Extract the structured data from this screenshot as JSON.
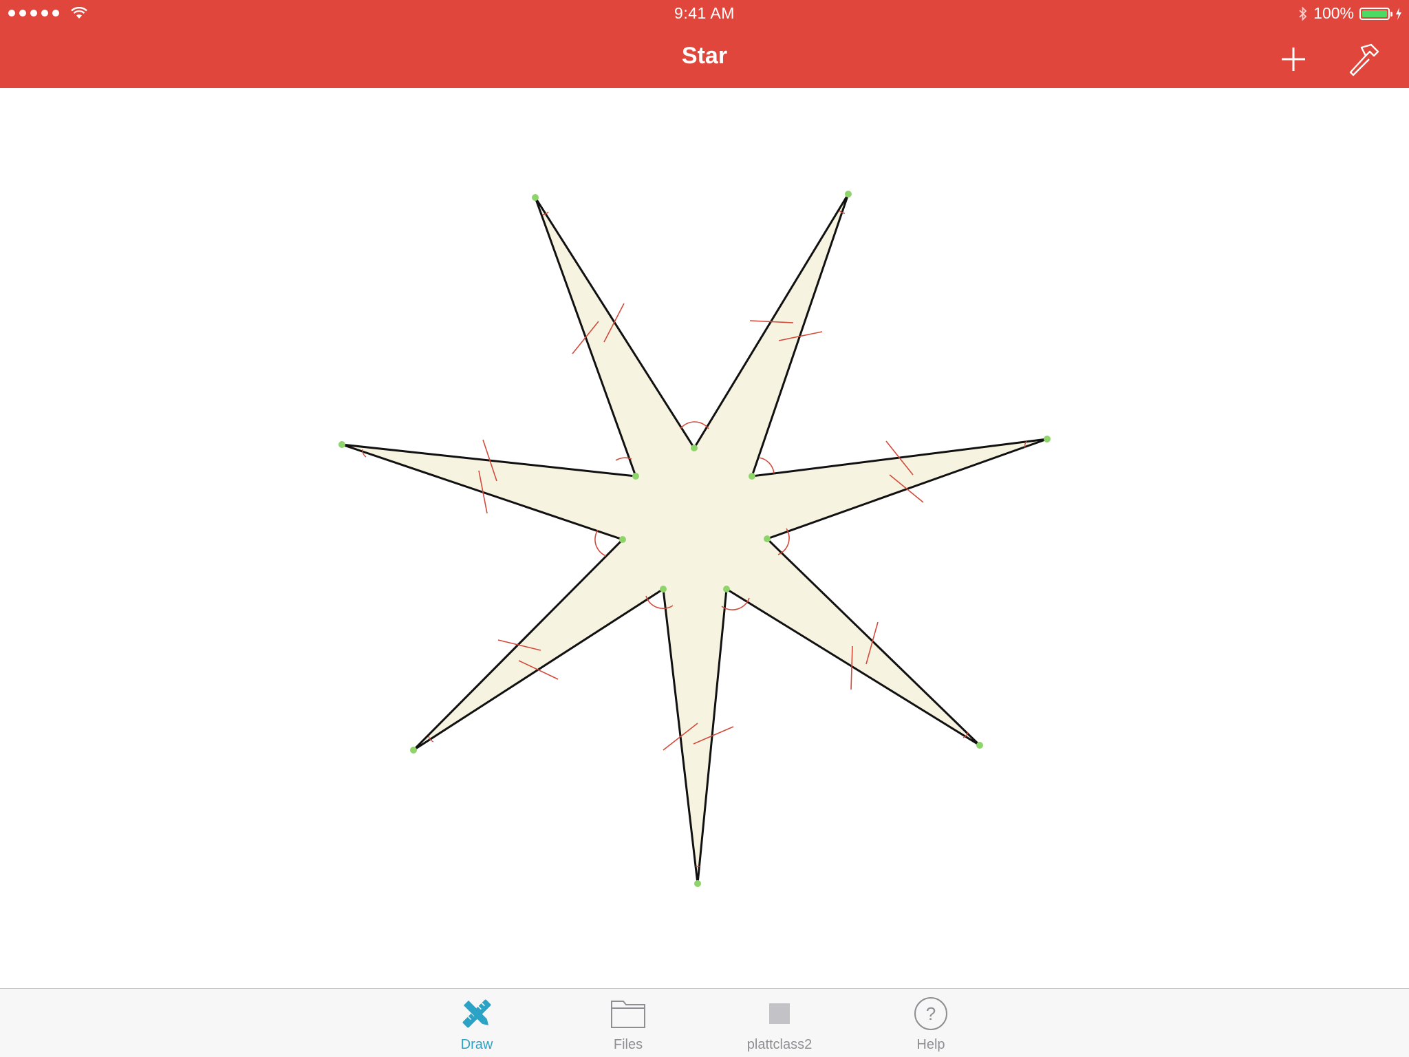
{
  "status_bar": {
    "time": "9:41 AM",
    "battery": "100%"
  },
  "nav": {
    "title": "Star",
    "add_icon": "plus-icon",
    "tools_icon": "hammer-icon"
  },
  "colors": {
    "bar": "#e1463c",
    "fill": "#f7f3e1",
    "stroke": "#111111",
    "vertex": "#8ed46b",
    "marks": "#d24a3c",
    "tab_active": "#2aa3c7",
    "tab_inactive": "#8e8e93"
  },
  "tabs": [
    {
      "label": "Draw",
      "icon": "draw-tools-icon",
      "active": true
    },
    {
      "label": "Files",
      "icon": "folder-icon",
      "active": false
    },
    {
      "label": "plattclass2",
      "icon": "square-icon",
      "active": false
    },
    {
      "label": "Help",
      "icon": "help-icon",
      "active": false
    }
  ]
}
